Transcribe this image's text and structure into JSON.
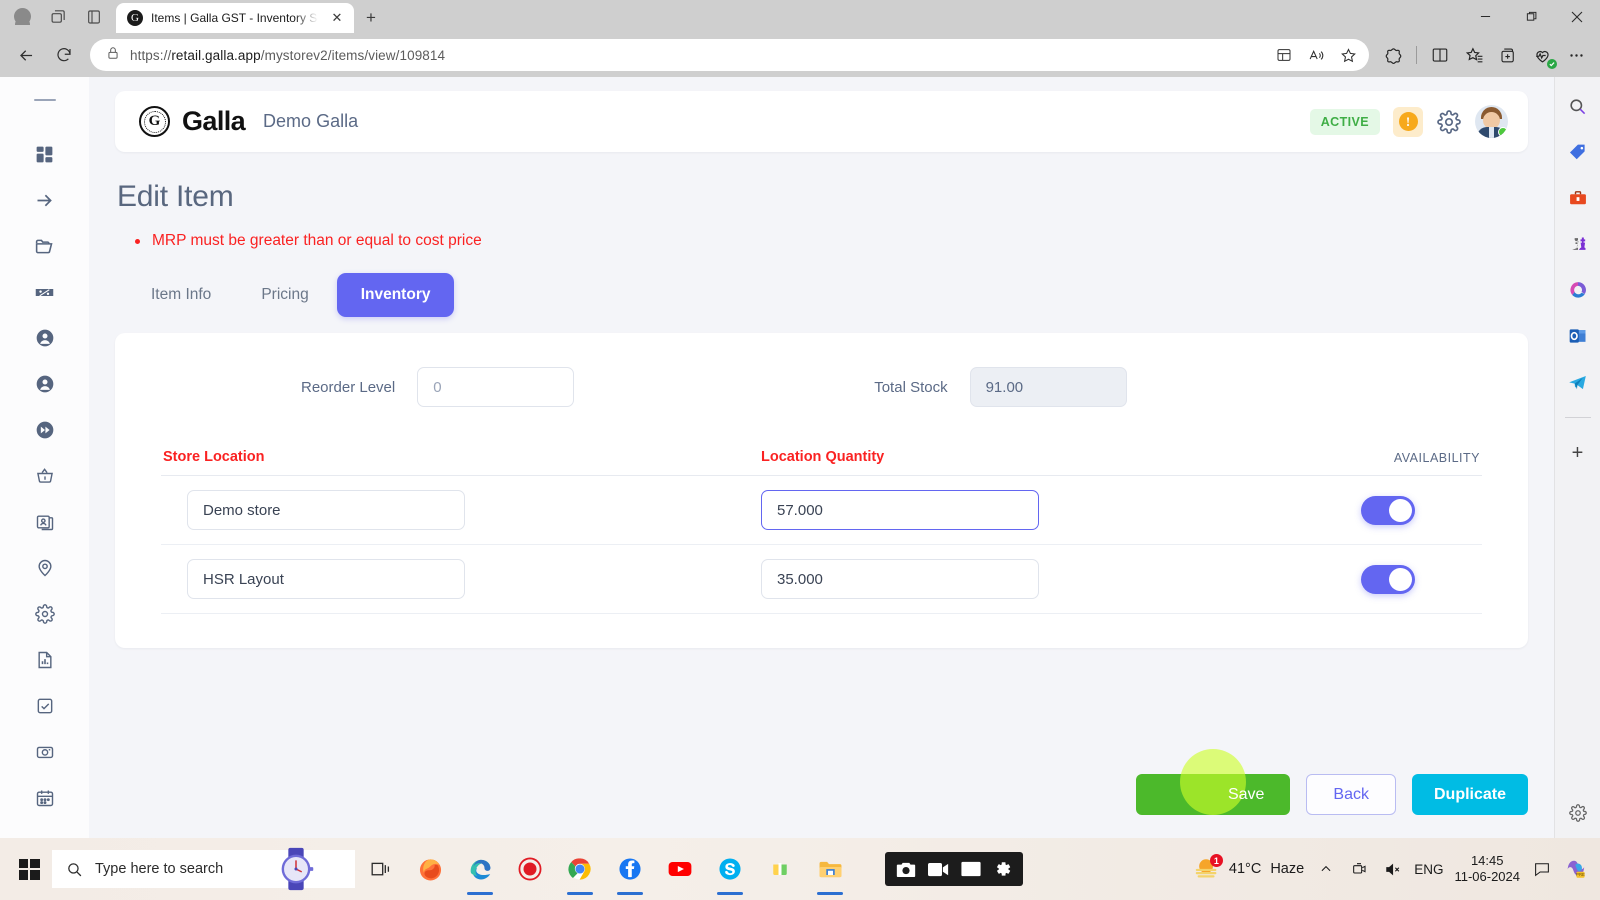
{
  "browser": {
    "tab": {
      "title": "Items | Galla GST - Inventory Soft",
      "favicon_label": "G",
      "close_label": "✕"
    },
    "new_tab_label": "+",
    "window_controls": {
      "minimize": "—",
      "restore": "❐",
      "close": "✕"
    },
    "url_prefix": "https://",
    "url_host": "retail.galla.app",
    "url_path": "/mystorev2/items/view/109814",
    "icons": {
      "profile": "profile-icon",
      "split_tabs": "vertical-tabs-icon",
      "collections_pane": "browser-pane-icon",
      "back": "back-arrow-icon",
      "refresh": "refresh-icon",
      "lock": "lock-icon",
      "split_screen_add": "split-screen-add-icon",
      "read_aloud": "read-aloud-icon",
      "favorite": "favorite-star-icon",
      "copilot": "copilot-icon",
      "split_screen": "split-screen-icon",
      "favorites_list": "favorites-list-icon",
      "collections": "collections-add-icon",
      "browser_essentials": "browser-essentials-icon",
      "settings_more": "more-options-icon"
    }
  },
  "app_rail": {
    "items": [
      {
        "name": "dashboard-icon"
      },
      {
        "name": "arrow-right-icon"
      },
      {
        "name": "folder-icon"
      },
      {
        "name": "discount-tag-icon"
      },
      {
        "name": "customer-icon"
      },
      {
        "name": "supplier-icon"
      },
      {
        "name": "fast-forward-icon"
      },
      {
        "name": "basket-icon"
      },
      {
        "name": "contact-card-icon"
      },
      {
        "name": "location-pin-icon"
      },
      {
        "name": "settings-gear-icon"
      },
      {
        "name": "report-document-icon"
      },
      {
        "name": "checkbox-icon"
      },
      {
        "name": "camera-icon"
      },
      {
        "name": "calendar-icon"
      }
    ]
  },
  "edge_rail": {
    "items": [
      {
        "name": "search-icon"
      },
      {
        "name": "shopping-tag-icon"
      },
      {
        "name": "tools-icon"
      },
      {
        "name": "games-icon"
      },
      {
        "name": "microsoft-365-icon"
      },
      {
        "name": "outlook-icon"
      },
      {
        "name": "telegram-icon"
      }
    ],
    "add_label": "+",
    "settings_icon": "sidebar-settings-icon"
  },
  "appbar": {
    "logo_mark": "G",
    "logo_text": "Galla",
    "store_name": "Demo Galla",
    "status_badge": "ACTIVE",
    "warning_symbol": "!",
    "icons": {
      "gear": "gear-icon",
      "avatar": "user-avatar"
    }
  },
  "page": {
    "title": "Edit Item",
    "errors": [
      "MRP must be greater than or equal to cost price"
    ],
    "tabs": [
      {
        "label": "Item Info",
        "active": false
      },
      {
        "label": "Pricing",
        "active": false
      },
      {
        "label": "Inventory",
        "active": true
      }
    ]
  },
  "form": {
    "reorder_level": {
      "label": "Reorder Level",
      "value": "",
      "placeholder": "0"
    },
    "total_stock": {
      "label": "Total Stock",
      "value": "91.00",
      "readonly": true
    }
  },
  "table": {
    "headers": {
      "store_location": "Store Location",
      "location_quantity": "Location Quantity",
      "availability": "AVAILABILITY"
    },
    "rows": [
      {
        "location": "Demo store",
        "quantity": "57.000",
        "available": true,
        "focused": true
      },
      {
        "location": "HSR Layout",
        "quantity": "35.000",
        "available": true,
        "focused": false
      }
    ]
  },
  "actions": {
    "save": "Save",
    "back": "Back",
    "duplicate": "Duplicate"
  },
  "colors": {
    "accent": "#6366f1",
    "error": "#fa2222",
    "save": "#4cb92b",
    "duplicate": "#00bce4",
    "active_badge_bg": "#e4f8e6",
    "active_badge_text": "#3fae46"
  },
  "taskbar": {
    "search_placeholder": "Type here to search",
    "icons": [
      {
        "name": "start-icon"
      },
      {
        "name": "cortana-watch-icon"
      },
      {
        "name": "task-view-icon"
      },
      {
        "name": "firefox-icon"
      },
      {
        "name": "edge-icon"
      },
      {
        "name": "screen-recorder-icon"
      },
      {
        "name": "chrome-icon"
      },
      {
        "name": "facebook-icon"
      },
      {
        "name": "youtube-icon"
      },
      {
        "name": "skype-icon"
      },
      {
        "name": "app-icon"
      },
      {
        "name": "file-explorer-icon"
      }
    ],
    "recorder_bar": [
      {
        "name": "screenshot-camera-icon"
      },
      {
        "name": "video-record-icon"
      },
      {
        "name": "screen-capture-icon"
      },
      {
        "name": "recorder-settings-icon"
      }
    ],
    "tray": {
      "weather_temp": "41°C",
      "weather_desc": "Haze",
      "weather_badge": "1",
      "language": "ENG",
      "time": "14:45",
      "date": "11-06-2024",
      "chevron": "∧"
    }
  }
}
